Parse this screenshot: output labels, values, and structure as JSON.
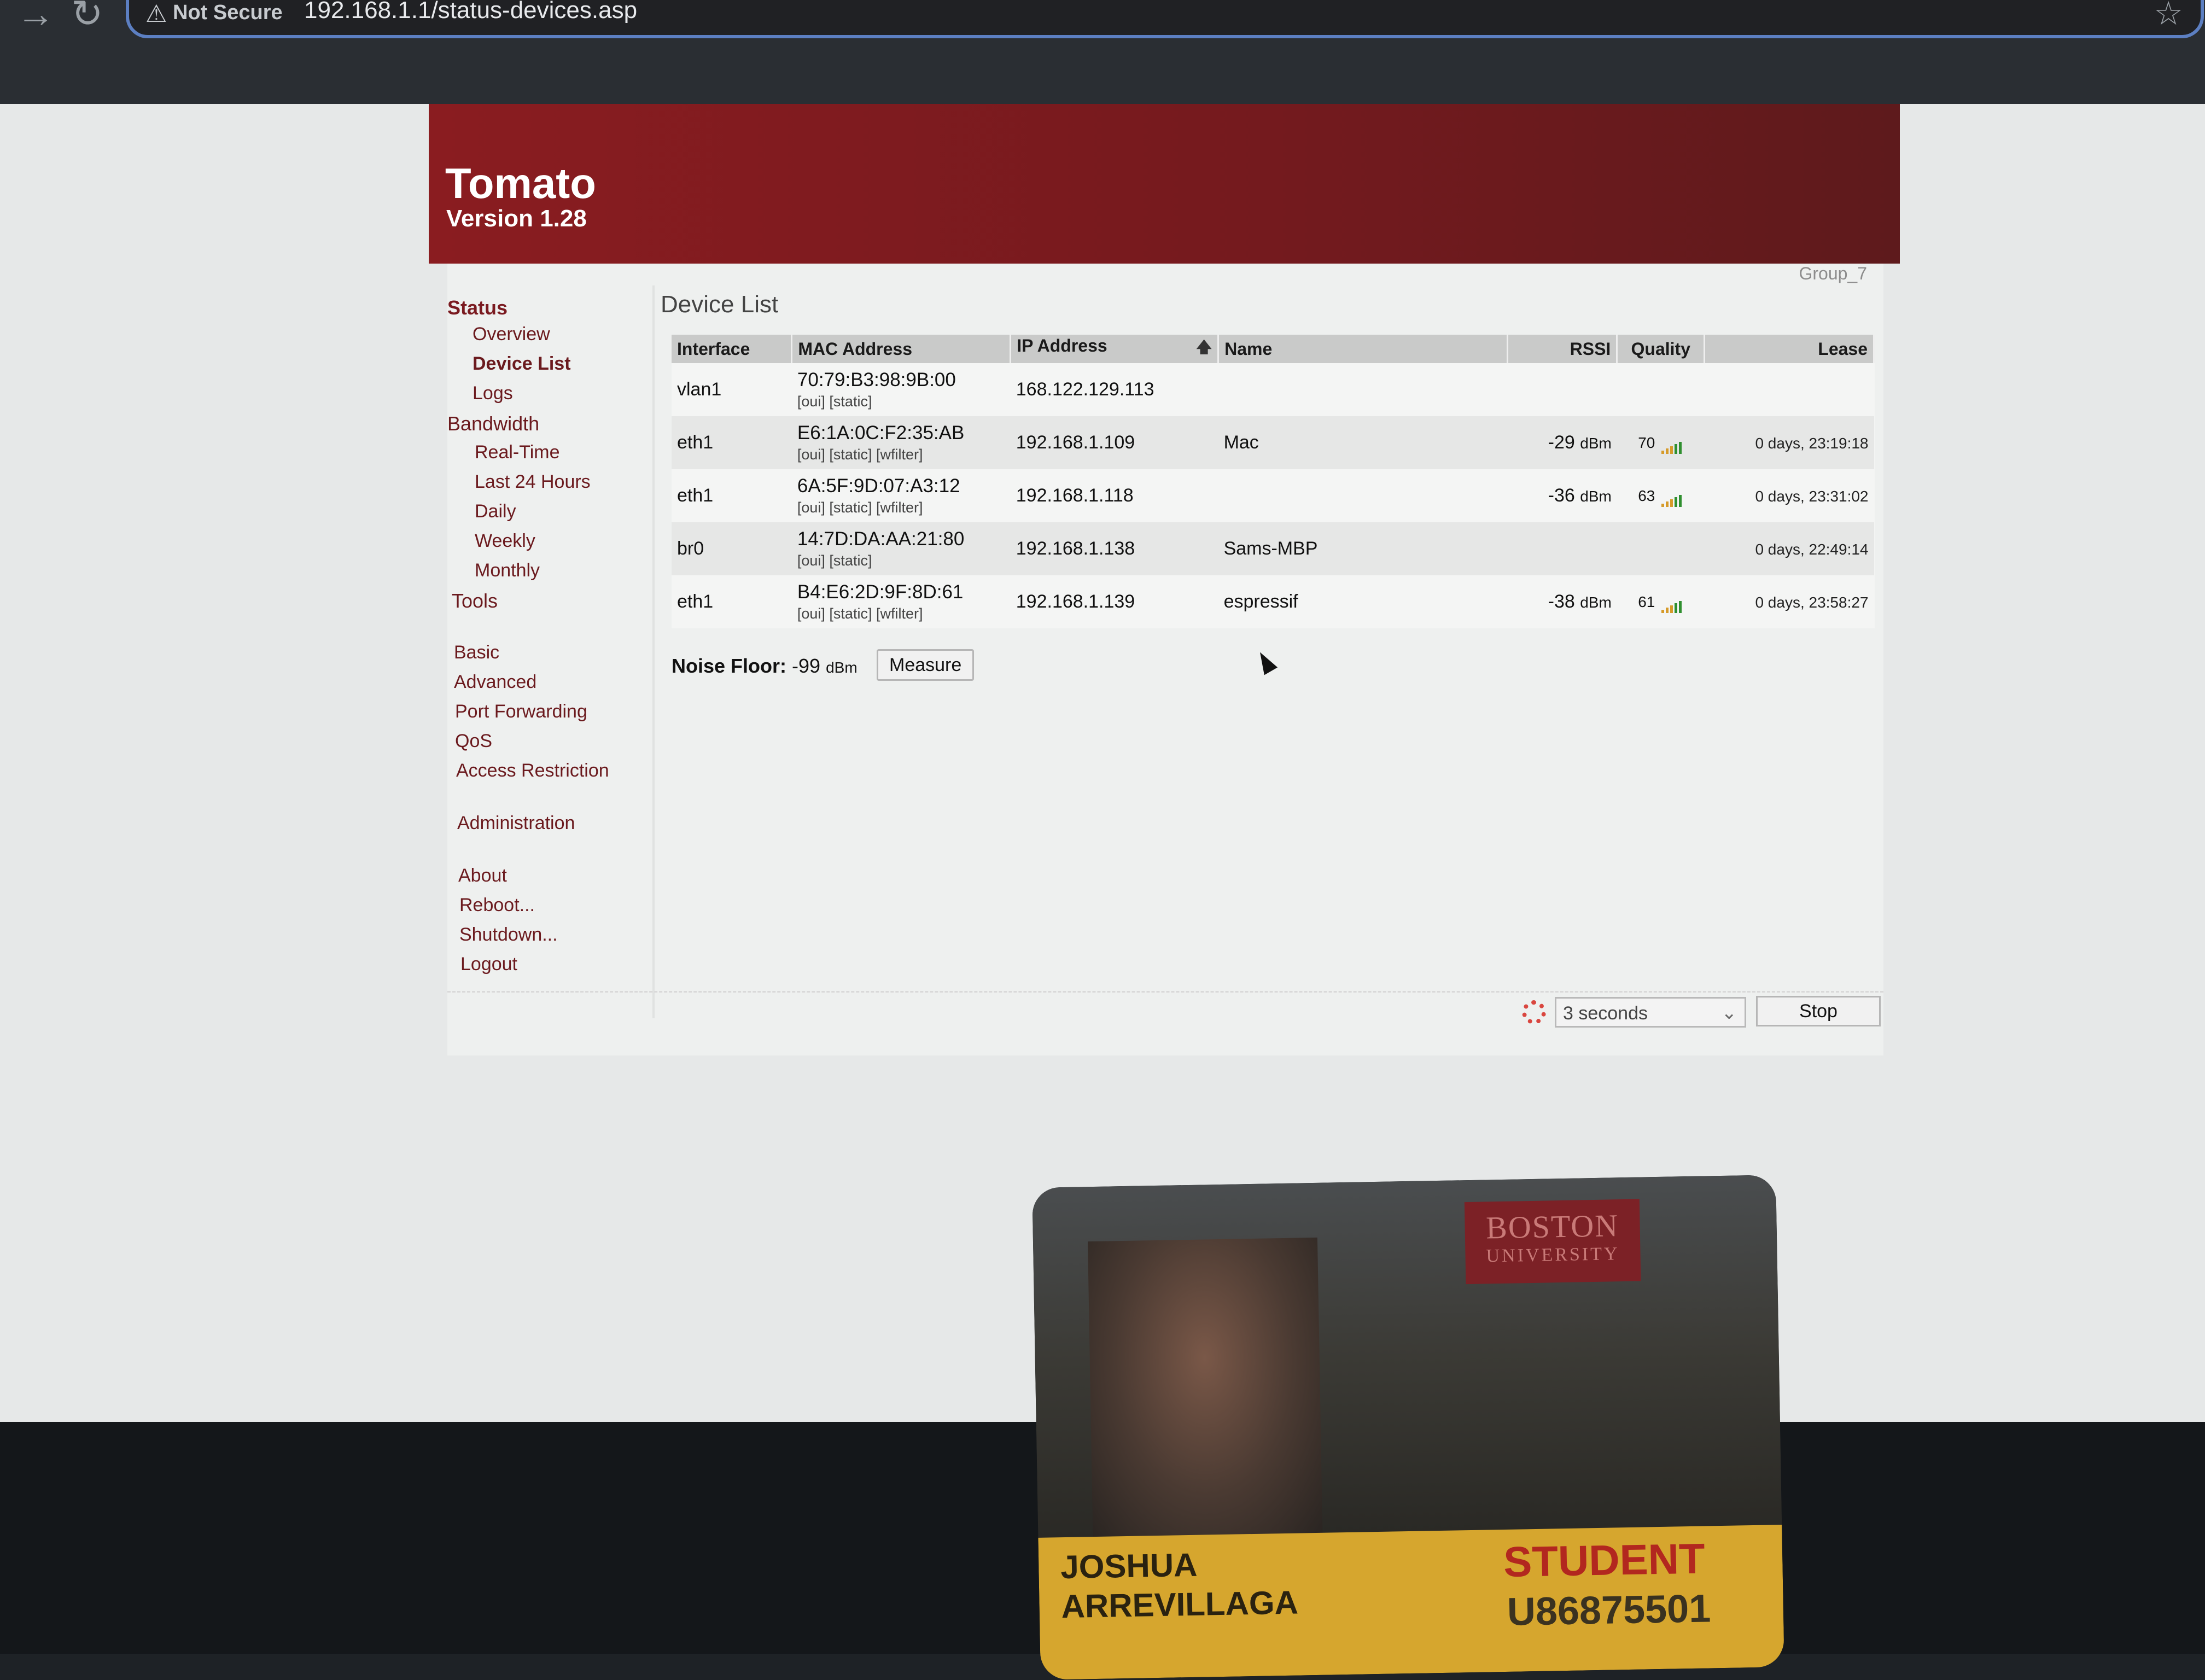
{
  "browser": {
    "security_label": "Not Secure",
    "url": "192.168.1.1/status-devices.asp"
  },
  "header": {
    "title": "Tomato",
    "version": "Version 1.28"
  },
  "router_name": "Group_7",
  "sidebar": {
    "status": "Status",
    "status_items": [
      "Overview",
      "Device List",
      "Logs"
    ],
    "bandwidth": "Bandwidth",
    "bandwidth_items": [
      "Real-Time",
      "Last 24 Hours",
      "Daily",
      "Weekly",
      "Monthly"
    ],
    "tools": "Tools",
    "settings_items": [
      "Basic",
      "Advanced",
      "Port Forwarding",
      "QoS",
      "Access Restriction"
    ],
    "administration": "Administration",
    "system_items": [
      "About",
      "Reboot...",
      "Shutdown...",
      "Logout"
    ]
  },
  "main": {
    "heading": "Device List",
    "columns": [
      "Interface",
      "MAC Address",
      "IP Address",
      "Name",
      "RSSI",
      "Quality",
      "Lease"
    ],
    "rows": [
      {
        "interface": "vlan1",
        "mac": "70:79:B3:98:9B:00",
        "tags": "[oui] [static]",
        "ip": "168.122.129.113",
        "name": "",
        "rssi": "",
        "rssi_unit": "",
        "quality": "",
        "lease": ""
      },
      {
        "interface": "eth1",
        "mac": "E6:1A:0C:F2:35:AB",
        "tags": "[oui] [static] [wfilter]",
        "ip": "192.168.1.109",
        "name": "Mac",
        "rssi": "-29",
        "rssi_unit": "dBm",
        "quality": "70",
        "lease": "0 days, 23:19:18"
      },
      {
        "interface": "eth1",
        "mac": "6A:5F:9D:07:A3:12",
        "tags": "[oui] [static] [wfilter]",
        "ip": "192.168.1.118",
        "name": "",
        "rssi": "-36",
        "rssi_unit": "dBm",
        "quality": "63",
        "lease": "0 days, 23:31:02"
      },
      {
        "interface": "br0",
        "mac": "14:7D:DA:AA:21:80",
        "tags": "[oui] [static]",
        "ip": "192.168.1.138",
        "name": "Sams-MBP",
        "rssi": "",
        "rssi_unit": "",
        "quality": "",
        "lease": "0 days, 22:49:14"
      },
      {
        "interface": "eth1",
        "mac": "B4:E6:2D:9F:8D:61",
        "tags": "[oui] [static] [wfilter]",
        "ip": "192.168.1.139",
        "name": "espressif",
        "rssi": "-38",
        "rssi_unit": "dBm",
        "quality": "61",
        "lease": "0 days, 23:58:27"
      }
    ],
    "noise_label": "Noise Floor:",
    "noise_value": "-99",
    "noise_unit": "dBm",
    "measure_label": "Measure"
  },
  "footer": {
    "refresh_interval": "3 seconds",
    "stop_label": "Stop"
  },
  "id_card": {
    "logo_line1": "BOSTON",
    "logo_line2": "UNIVERSITY",
    "first_name": "JOSHUA",
    "last_name": "ARREVILLAGA",
    "role": "STUDENT",
    "id_number": "U86875501"
  },
  "colors": {
    "header_red": "#8a1c20",
    "link_maroon": "#6b1a1e",
    "signal_green": "#2f8f2f",
    "signal_orange": "#d69b2a",
    "card_gold": "#d6a62e",
    "card_red": "#b2271f"
  }
}
